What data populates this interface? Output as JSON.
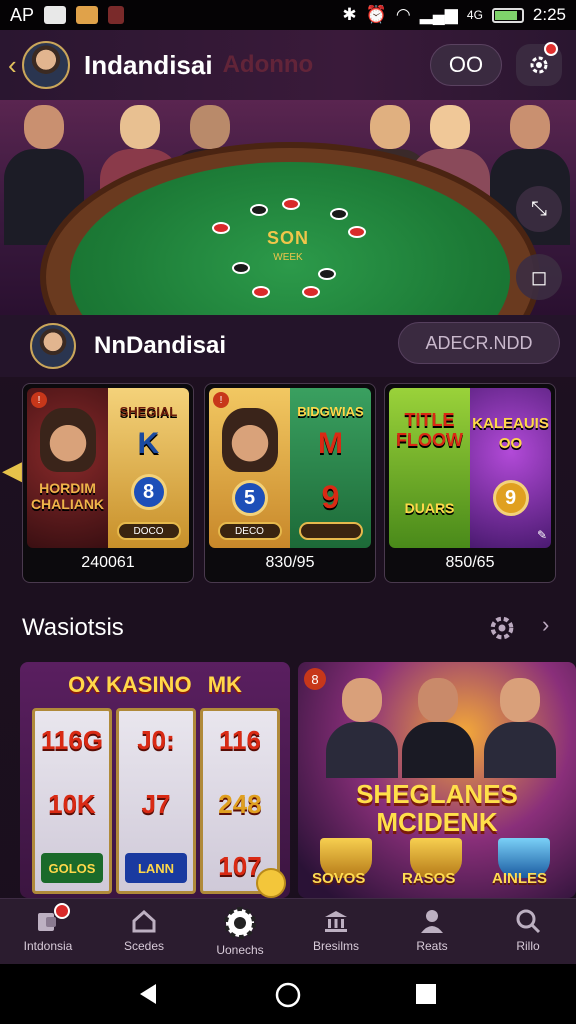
{
  "status_bar": {
    "carrier": "AP",
    "network": "4G",
    "time": "2:25"
  },
  "header": {
    "title": "Indandisai",
    "ghost_text": "Adonno",
    "coins_label": "OO"
  },
  "hero": {
    "table_title": "SON",
    "table_subtitle": "WEEK"
  },
  "profile": {
    "name": "NnDandisai",
    "action_label": "ADECR.NDD"
  },
  "game_cards": [
    {
      "top_text": "SHEGIAL",
      "art_text": "HORDIM CHALIANK",
      "mid_symbol": "K",
      "ball_number": "8",
      "pill_label": "DOCO",
      "value": "240061"
    },
    {
      "top_text": "BIDGWIAS",
      "mid_symbol": "M",
      "ball_number": "5",
      "right_number": "9",
      "pill_label": "DECO",
      "value": "830/95"
    },
    {
      "top_text": "TITLE FLOOW",
      "art_text": "DUARS",
      "right_title": "KALEAUIS OO",
      "right_number": "9",
      "value": "850/65"
    }
  ],
  "section": {
    "title": "Wasiotsis"
  },
  "promos": {
    "left": {
      "title": "OX KASINO",
      "title_badge": "MK",
      "reels": [
        [
          "116G",
          "10K",
          "GOLOS"
        ],
        [
          "J0:",
          "J7",
          "LANN"
        ],
        [
          "116",
          "248",
          "107"
        ]
      ]
    },
    "right": {
      "badge": "8",
      "headline_1": "SHEGLANES",
      "headline_2": "MCIDENK",
      "prizes": [
        "SOVOS",
        "RASOS",
        "AINLES"
      ]
    }
  },
  "bottom_nav": [
    {
      "label": "Intdonsia",
      "icon": "wallet-icon"
    },
    {
      "label": "Scedes",
      "icon": "home-icon"
    },
    {
      "label": "Uonechs",
      "icon": "poker-chip-icon"
    },
    {
      "label": "Bresilms",
      "icon": "bank-icon"
    },
    {
      "label": "Reats",
      "icon": "person-icon"
    },
    {
      "label": "Rillo",
      "icon": "search-icon"
    }
  ],
  "colors": {
    "accent_gold": "#e6b94c",
    "background": "#1d1020",
    "felt_green": "#1c7a36",
    "notification_red": "#e0302f"
  }
}
